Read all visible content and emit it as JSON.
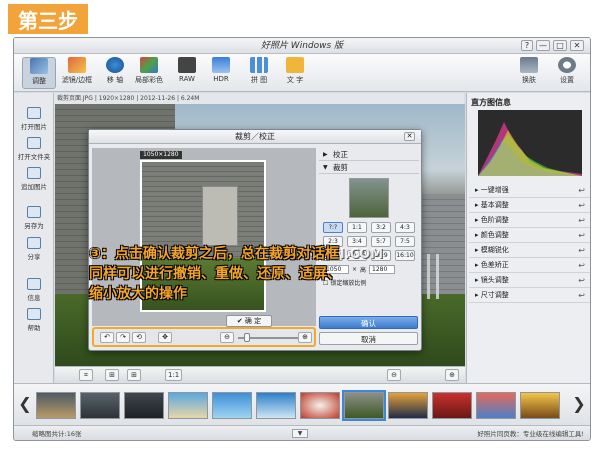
{
  "step_badge": "第三步",
  "window": {
    "title": "好照片 Windows 版",
    "controls": [
      "?",
      "—",
      "□",
      "✕"
    ]
  },
  "toolbar": {
    "items": [
      {
        "label": "调整",
        "icon": "adjust-icon"
      },
      {
        "label": "滤镜/边框",
        "icon": "filter-icon"
      },
      {
        "label": "移 轴",
        "icon": "tilt-shift-icon"
      },
      {
        "label": "局部彩色",
        "icon": "local-color-icon"
      },
      {
        "label": "RAW",
        "icon": "raw-icon"
      },
      {
        "label": "HDR",
        "icon": "hdr-icon"
      },
      {
        "label": "拼 图",
        "icon": "collage-icon"
      },
      {
        "label": "文 字",
        "icon": "text-icon"
      }
    ],
    "right_items": [
      {
        "label": "换肤",
        "icon": "skin-icon"
      },
      {
        "label": "设置",
        "icon": "gear-icon"
      }
    ]
  },
  "infobar": "裁剪页面.JPG  |  1920×1280  |  2012-11-26  |  6.24M",
  "leftbar": {
    "items": [
      {
        "label": "打开图片",
        "icon": "open-image-icon"
      },
      {
        "label": "打开文件夹",
        "icon": "open-folder-icon"
      },
      {
        "label": "追加图片",
        "icon": "add-image-icon"
      },
      {
        "label": "另存为",
        "icon": "save-as-icon"
      },
      {
        "label": "分享",
        "icon": "share-icon"
      },
      {
        "label": "信息",
        "icon": "info-icon"
      },
      {
        "label": "帮助",
        "icon": "help-icon"
      }
    ]
  },
  "dialog": {
    "title": "裁剪／校正",
    "close": "✕",
    "size_label": "1050×1280",
    "confirm_mini": "✔ 确 定",
    "sections": {
      "correct": "校正",
      "crop": "裁剪"
    },
    "ratios": [
      "?:?",
      "1:1",
      "3:2",
      "4:3",
      "2:3",
      "3:4",
      "5:7",
      "7:5",
      "9:16",
      "10:16",
      "16:9",
      "16:10"
    ],
    "size": {
      "width": "1050",
      "times": "×",
      "height_label": "高",
      "height": "1280"
    },
    "lock_ratio": "锁定缩放比例",
    "ok": "确认",
    "cancel": "取消",
    "tools": {
      "undo": "↶",
      "redo": "↷",
      "reset": "⟲",
      "fit": "✥",
      "zoom_out": "⊖",
      "zoom_in": "⊕"
    }
  },
  "annotation": {
    "line1": "③：点击确认裁剪之后，总在裁剪对话框",
    "line2": "同样可以进行撤销、重做、还原、适屏、",
    "line3": "缩小放大的操作"
  },
  "watermark": "三联网 3LIAN.COM",
  "right_panel": {
    "title": "直方图信息",
    "items": [
      "一键增强",
      "基本调整",
      "色阶调整",
      "颜色调整",
      "模糊锐化",
      "色差矫正",
      "镜头调整",
      "尺寸调整"
    ]
  },
  "photo_tools": {
    "crop": "⌗",
    "fit": "⊞",
    "one_to_one": "1:1",
    "zoom_out": "⊖",
    "zoom_in": "⊕"
  },
  "filmstrip": {
    "prev": "❮",
    "next": "❯",
    "thumb_count": 12,
    "selected_index": 7
  },
  "statusbar": {
    "left": "缩略图共计:16张",
    "right": "好照片同页教：专业级在线编辑工具!"
  }
}
